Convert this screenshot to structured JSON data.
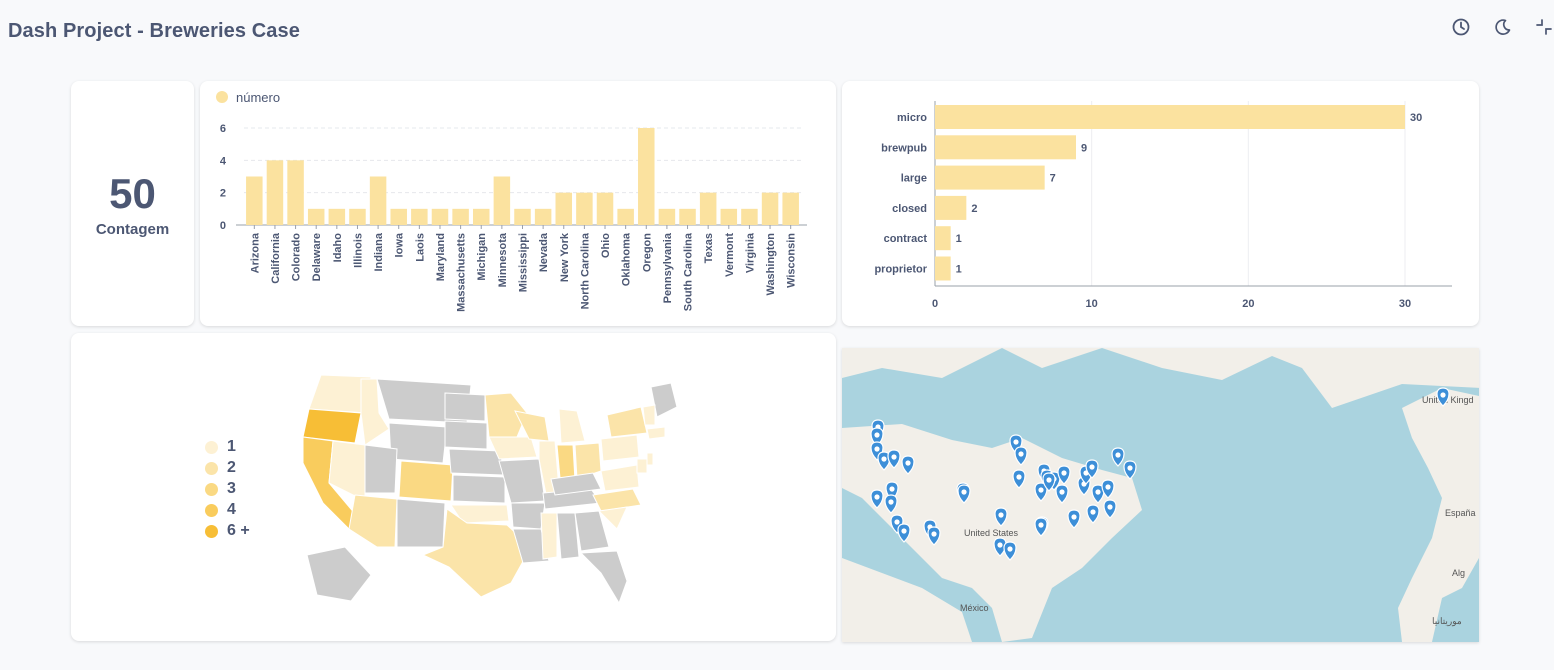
{
  "header": {
    "title": "Dash Project - Breweries Case"
  },
  "icons": {
    "history": "clock-icon",
    "theme": "moon-icon",
    "fullscreen": "collapse-icon"
  },
  "scalar": {
    "value": "50",
    "label": "Contagem"
  },
  "bar_chart": {
    "legend_label": "número",
    "color": "#fbe29f"
  },
  "type_chart": {
    "color": "#fbe29f"
  },
  "choropleth": {
    "legend": [
      "1",
      "2",
      "3",
      "4",
      "6 +"
    ],
    "colors": [
      "#fdf1d4",
      "#fbe4a9",
      "#fad983",
      "#f9cc5d",
      "#f7be36"
    ]
  },
  "map": {
    "labels": {
      "us": "United States",
      "mexico": "México",
      "uk": "United Kingd",
      "spain": "España",
      "algeria": "Alg",
      "morocco": "موريتانيا"
    }
  },
  "chart_data": [
    {
      "type": "bar",
      "categories": [
        "Arizona",
        "California",
        "Colorado",
        "Delaware",
        "Idaho",
        "Illinois",
        "Indiana",
        "Iowa",
        "Laois",
        "Maryland",
        "Massachusetts",
        "Michigan",
        "Minnesota",
        "Mississippi",
        "Nevada",
        "New York",
        "North Carolina",
        "Ohio",
        "Oklahoma",
        "Oregon",
        "Pennsylvania",
        "South Carolina",
        "Texas",
        "Vermont",
        "Virginia",
        "Washington",
        "Wisconsin"
      ],
      "series": [
        {
          "name": "número",
          "values": [
            3,
            4,
            4,
            1,
            1,
            1,
            3,
            1,
            1,
            1,
            1,
            1,
            3,
            1,
            1,
            2,
            2,
            2,
            1,
            6,
            1,
            1,
            2,
            1,
            1,
            2,
            2
          ]
        }
      ],
      "ylim": [
        0,
        6
      ],
      "yticks": [
        "0",
        "2",
        "4",
        "6"
      ]
    },
    {
      "type": "bar",
      "orientation": "horizontal",
      "categories": [
        "micro",
        "brewpub",
        "large",
        "closed",
        "contract",
        "proprietor"
      ],
      "values": [
        30,
        9,
        7,
        2,
        1,
        1
      ],
      "xlim": [
        0,
        33
      ],
      "xticks": [
        "0",
        "10",
        "20",
        "30"
      ]
    }
  ]
}
